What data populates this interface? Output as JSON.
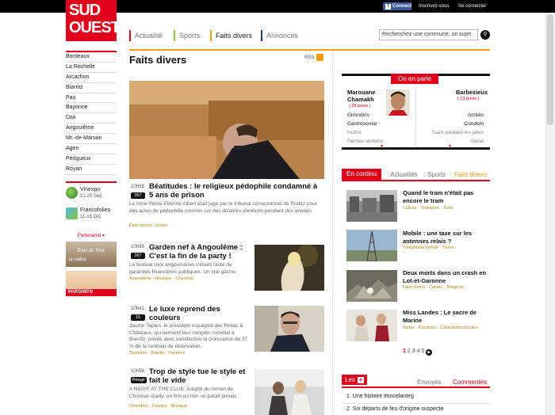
{
  "header": {
    "connect_label": "Connect",
    "register_label": "Inscrivez-vous",
    "login_label": "Se connecter",
    "logo_line1": "SUD",
    "logo_line2": "OUEST",
    "brand_color": "#e0001b",
    "nav": [
      {
        "label": "Actualité",
        "color": "#e0001b"
      },
      {
        "label": "Sports",
        "color": "#8dc63f"
      },
      {
        "label": "Faits divers",
        "color": "#f39b12"
      },
      {
        "label": "Annonces",
        "color": "#1f3c88"
      }
    ],
    "search_placeholder": "Recherchez une commune, un sujet",
    "search_icon": "search-icon"
  },
  "sidebar": {
    "cities": [
      "Bordeaux",
      "La Rochelle",
      "Arcachon",
      "Biarritz",
      "Pau",
      "Bayonne",
      "Dax",
      "Angoulême",
      "Mt.-de-Marsan",
      "Agen",
      "Périgueux",
      "Royan"
    ],
    "events": [
      {
        "title": "Vinexpo",
        "date": "21-25 Sep"
      },
      {
        "title": "Francofolies",
        "date": "11-16 Oct"
      }
    ],
    "partenariat_label": "Partenariat ▾",
    "ad1_text": "Tous de Vins",
    "ad1_sub": "la valise",
    "ad2_brand": "PARSHIP.fr"
  },
  "main": {
    "title": "Faits divers",
    "rss_label": "RSS",
    "articles": [
      {
        "time": "10h58",
        "badge": "367",
        "title": "Béatitudes : le religieux pédophile condamné à 5 ans de prison",
        "text": "Le frère Pierre-Etienne Albert était jugé par le tribunal correctionnel de Rodez pour des actes de pédophilie commis sur des dizaines d'enfants pendant des années",
        "tags": "Faits divers · justice"
      },
      {
        "time": "10h58",
        "badge": "367",
        "title": "Garden nef à Angoulême : C'est la fin de la party !",
        "text": "Le festival rock angoumoisin s'éteint faute de garanties financières publiques. Un vrai gâchis",
        "tags": "Angoulême · Musique · Charente"
      },
      {
        "time": "10h41",
        "badge": "15",
        "title": "Le luxe reprend des couleurs",
        "text": "Jaume Tapies, le président espagnol des Relais & Châteaux, qui tiennent leur congrès mondial à Biarritz, pointe avec satisfaction la croissance de 37 % de la centrale de réservation.",
        "tags": "Tourisme · Biarritz · Puymirol"
      },
      {
        "time": "10h58",
        "badge": "Réagir",
        "title": "Trop de style tue le style et fait le vide",
        "text": "A NIGHT AT THE CLUB. Adapté du roman de Christian Gailly, un film où rien ne parait jamais",
        "tags": "Chambon · Cinéma · Musique"
      }
    ]
  },
  "right": {
    "on_en_parle": {
      "tab_label": "On en parle",
      "left_name": "Marouane Chamakh",
      "left_posts": "( 28 posts )",
      "left_items": [
        "Girondins",
        "Gastronomie",
        "Huître",
        "Rentée scolaire"
      ],
      "right_name": "Barbezieux",
      "right_posts": "( 13 posts )",
      "right_items": [
        "Ambès",
        "Condom",
        "Saint-médard-en-jalles",
        "Sarlat"
      ]
    },
    "en_continu": {
      "tab_label": "En continu",
      "filters": [
        "Actualités",
        "Sports",
        "Faits divers"
      ],
      "items": [
        {
          "title": "Quand le tram n'était pas encore le tram",
          "tags": "Culture · Transport · Tram"
        },
        {
          "title": "Mobile : une taxe sur les antennes relais ?",
          "tags": "Téléphonie mobile · Taxes"
        },
        {
          "title": "Deux morts dans un crash en Lot-et-Garonne",
          "tags": "Faits divers · Cavarc · Bergerac"
        },
        {
          "title": "Miss Landes : Le sacre de Marine",
          "tags": "Tartas · Élections · Collectivités locales"
        }
      ],
      "pages": [
        "1",
        "2",
        "3",
        "4",
        "5"
      ]
    },
    "les": {
      "tab_label": "Les",
      "filters": [
        "Envoyés",
        "Commentés"
      ],
      "items": [
        {
          "num": "1",
          "text": "Une histoire étincelanteg"
        },
        {
          "num": "2",
          "text": "Six départs de feu d'origine suspecte"
        }
      ]
    }
  }
}
